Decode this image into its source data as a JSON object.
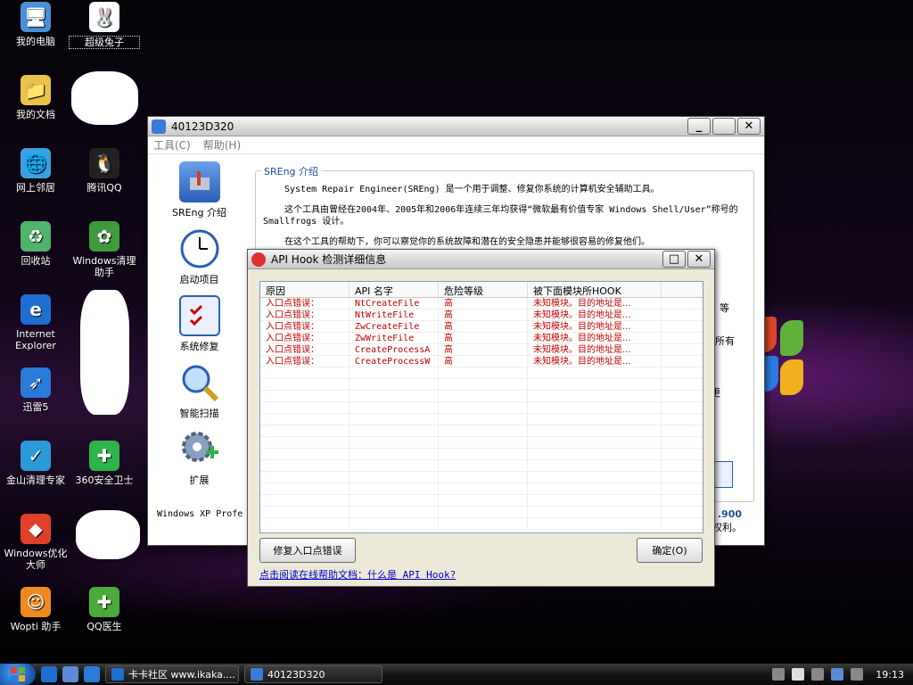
{
  "desktop": {
    "icons": [
      {
        "label": "我的电脑",
        "color": "#4a8fd8"
      },
      {
        "label": "超级兔子",
        "color": "#ffffff"
      },
      {
        "label": "我的文档",
        "color": "#e8c34a"
      },
      {
        "label": "网上邻居",
        "color": "#3aa0e0"
      },
      {
        "label": "腾讯QQ",
        "color": "#222222"
      },
      {
        "label": "回收站",
        "color": "#4fb36b"
      },
      {
        "label": "Windows清理助手",
        "color": "#3d9a3d"
      },
      {
        "label": "Internet Explorer",
        "color": "#1e6fd0"
      },
      {
        "label": "迅雷5",
        "color": "#2a7ad8"
      },
      {
        "label": "金山清理专家",
        "color": "#2c9ad8"
      },
      {
        "label": "360安全卫士",
        "color": "#2fb34a"
      },
      {
        "label": "Windows优化大师",
        "color": "#e0402a"
      },
      {
        "label": "Wopti 助手",
        "color": "#f08a20"
      },
      {
        "label": "QQ医生",
        "color": "#4aaa3a"
      }
    ]
  },
  "main_window": {
    "title": "40123D320",
    "menu": [
      "工具(C)",
      "帮助(H)"
    ],
    "nav": [
      {
        "label": "SREng 介绍"
      },
      {
        "label": "启动项目"
      },
      {
        "label": "系统修复"
      },
      {
        "label": "智能扫描"
      },
      {
        "label": "扩展"
      }
    ],
    "group_title": "SREng 介绍",
    "intro_1": "System Repair Engineer(SREng) 是一个用于调整、修复你系统的计算机安全辅助工具。",
    "intro_2": "这个工具由曾经在2004年、2005年和2006年连续三年均获得“微软最有价值专家 Windows Shell/User”称号的 Smallfrogs 设计。",
    "intro_3": "在这个工具的帮助下，你可以察觉你的系统故障和潜在的安全隐患并能够很容易的修复他们。",
    "frag_1": "等",
    "frag_2": "所有",
    "frag_3": "更",
    "status_left": "Windows XP Profe",
    "version": ".900",
    "rights": "有权利。"
  },
  "dialog": {
    "title": "API Hook 检测详细信息",
    "columns": [
      "原因",
      "API 名字",
      "危险等级",
      "被下面模块所HOOK"
    ],
    "rows": [
      {
        "reason": "入口点错误：",
        "api": "NtCreateFile",
        "level": "高",
        "module": "未知模块。目的地址是..."
      },
      {
        "reason": "入口点错误：",
        "api": "NtWriteFile",
        "level": "高",
        "module": "未知模块。目的地址是..."
      },
      {
        "reason": "入口点错误：",
        "api": "ZwCreateFile",
        "level": "高",
        "module": "未知模块。目的地址是..."
      },
      {
        "reason": "入口点错误：",
        "api": "ZwWriteFile",
        "level": "高",
        "module": "未知模块。目的地址是..."
      },
      {
        "reason": "入口点错误：",
        "api": "CreateProcessA",
        "level": "高",
        "module": "未知模块。目的地址是..."
      },
      {
        "reason": "入口点错误：",
        "api": "CreateProcessW",
        "level": "高",
        "module": "未知模块。目的地址是..."
      }
    ],
    "fix_button": "修复入口点错误",
    "ok_button": "确定(O)",
    "help_link": "点击阅读在线帮助文档：什么是 API Hook?"
  },
  "taskbar": {
    "tasks": [
      {
        "label": "卡卡社区 www.ikaka...."
      },
      {
        "label": "40123D320"
      }
    ],
    "clock": "19:13"
  }
}
